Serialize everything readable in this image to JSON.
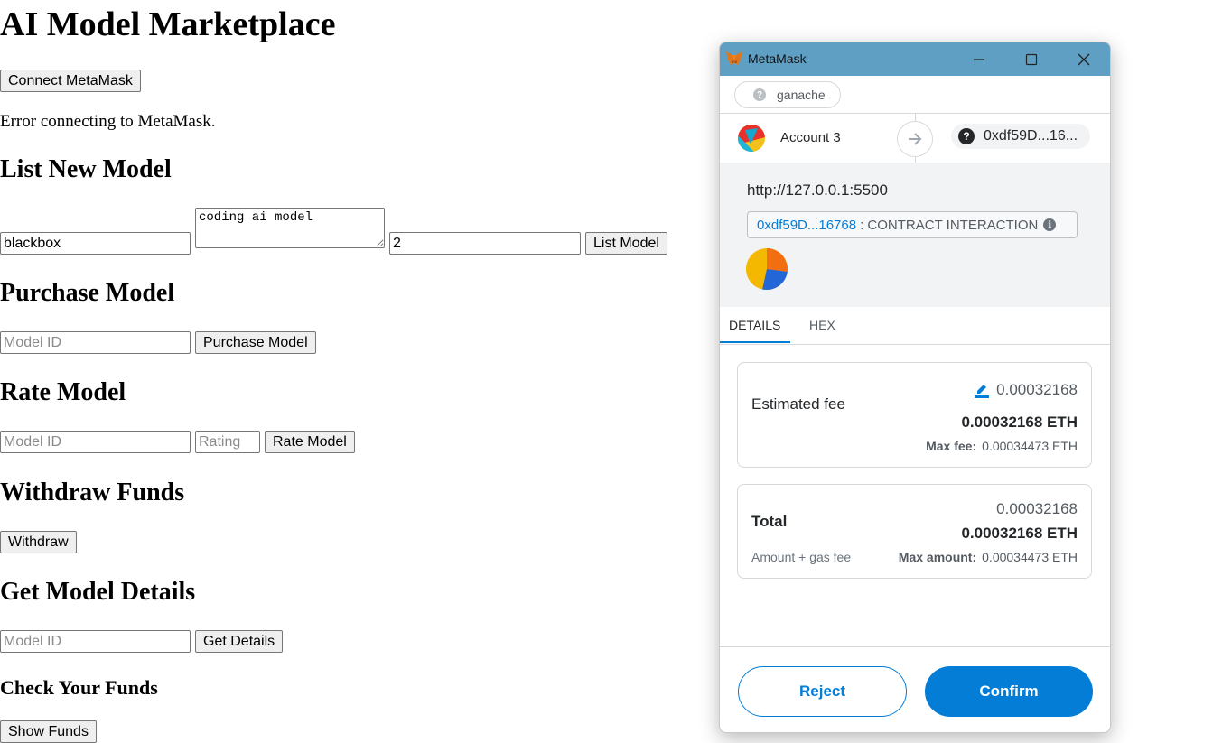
{
  "page": {
    "title": "AI Model Marketplace",
    "connect_button": "Connect MetaMask",
    "error_text": "Error connecting to MetaMask.",
    "list": {
      "heading": "List New Model",
      "name_value": "blackbox",
      "description_value": "coding ai model",
      "price_value": "2",
      "button": "List Model"
    },
    "purchase": {
      "heading": "Purchase Model",
      "id_placeholder": "Model ID",
      "button": "Purchase Model"
    },
    "rate": {
      "heading": "Rate Model",
      "id_placeholder": "Model ID",
      "rating_placeholder": "Rating",
      "button": "Rate Model"
    },
    "withdraw": {
      "heading": "Withdraw Funds",
      "button": "Withdraw"
    },
    "details": {
      "heading": "Get Model Details",
      "id_placeholder": "Model ID",
      "button": "Get Details"
    },
    "funds": {
      "heading": "Check Your Funds",
      "button": "Show Funds"
    }
  },
  "metamask": {
    "window_title": "MetaMask",
    "network": "ganache",
    "account_name": "Account 3",
    "recipient": "0xdf59D...16...",
    "origin": "http://127.0.0.1:5500",
    "contract_address": "0xdf59D...16768",
    "contract_label": ": CONTRACT INTERACTION",
    "tabs": [
      "DETAILS",
      "HEX"
    ],
    "fee": {
      "label": "Estimated fee",
      "secondary": "0.00032168",
      "primary": "0.00032168 ETH",
      "max_label": "Max fee:",
      "max_value": "0.00034473 ETH"
    },
    "total": {
      "label": "Total",
      "sublabel": "Amount + gas fee",
      "secondary": "0.00032168",
      "primary": "0.00032168 ETH",
      "max_label": "Max amount:",
      "max_value": "0.00034473 ETH"
    },
    "reject_button": "Reject",
    "confirm_button": "Confirm",
    "colors": {
      "titlebar": "#5f9fc4",
      "primary_blue": "#037dd6"
    },
    "icons": [
      "metamask-fox-icon",
      "minimize-icon",
      "maximize-icon",
      "close-icon",
      "question-icon",
      "arrow-right-icon",
      "info-icon",
      "edit-icon"
    ]
  }
}
